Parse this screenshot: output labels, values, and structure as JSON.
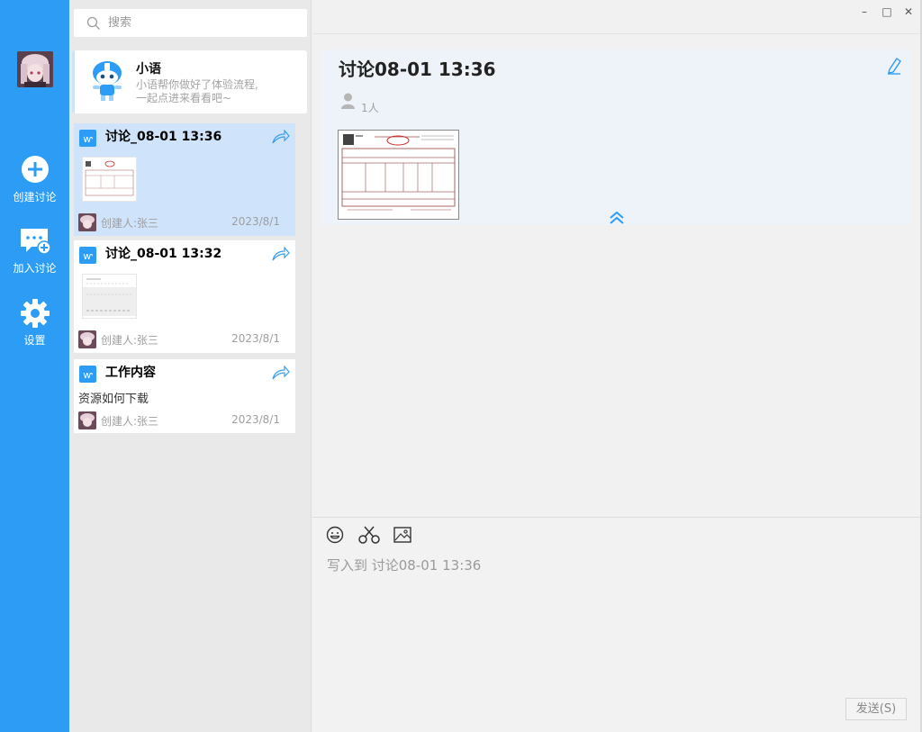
{
  "window": {
    "minimize": "–",
    "maximize": "□",
    "close": "✕"
  },
  "rail": {
    "items": [
      {
        "label": "创建讨论",
        "icon": "plus-circle-icon"
      },
      {
        "label": "加入讨论",
        "icon": "chat-add-icon"
      },
      {
        "label": "设置",
        "icon": "gear-icon"
      }
    ]
  },
  "search": {
    "placeholder": "搜索"
  },
  "assistant": {
    "name": "小语",
    "desc_line1": "小语帮你做好了体验流程,",
    "desc_line2": "一起点进来看看吧~"
  },
  "discussions": [
    {
      "title": "讨论_08-01 13:36",
      "creator": "创建人:张三",
      "date": "2023/8/1",
      "active": true
    },
    {
      "title": "讨论_08-01 13:32",
      "creator": "创建人:张三",
      "date": "2023/8/1",
      "active": false
    },
    {
      "title": "工作内容",
      "text": "资源如何下载",
      "creator": "创建人:张三",
      "date": "2023/8/1",
      "active": false
    }
  ],
  "main": {
    "title": "讨论08-01 13:36",
    "members": "1人",
    "compose_placeholder": "写入到 讨论08-01 13:36",
    "send_label": "发送(S)"
  },
  "colors": {
    "accent": "#2d9cf5",
    "active_card": "#cfe4fb",
    "header_bg": "#eef3fa"
  }
}
